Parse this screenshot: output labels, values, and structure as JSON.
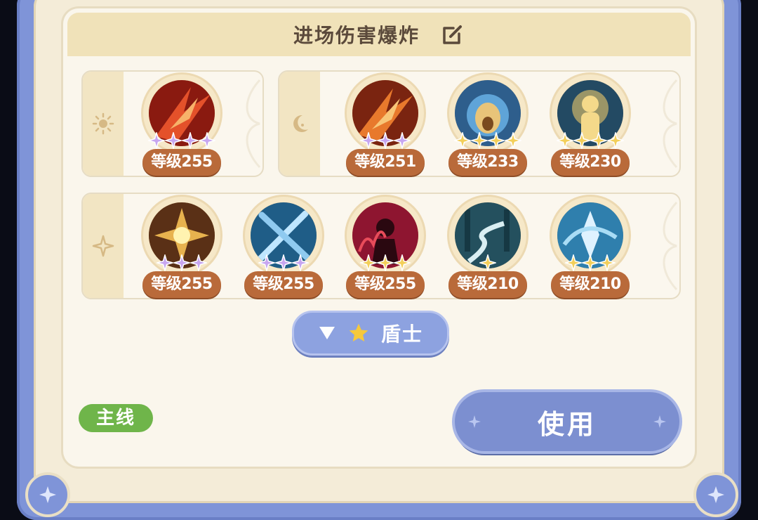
{
  "title": "进场伤害爆炸",
  "groups": [
    {
      "name": "sun",
      "icon": "sun-icon",
      "skills": [
        {
          "icon": "flame-slash-icon",
          "level_text": "等级255",
          "stars": 4,
          "star_color": "purple"
        }
      ]
    },
    {
      "name": "moon",
      "icon": "moon-icon",
      "skills": [
        {
          "icon": "flame-slash-icon",
          "level_text": "等级251",
          "stars": 3,
          "star_color": "purple"
        },
        {
          "icon": "lion-roar-icon",
          "level_text": "等级233",
          "stars": 4,
          "star_color": "gold"
        },
        {
          "icon": "golden-warrior-icon",
          "level_text": "等级230",
          "stars": 4,
          "star_color": "gold"
        }
      ]
    },
    {
      "name": "star",
      "icon": "sparkle-icon",
      "skills": [
        {
          "icon": "golden-star-burst-icon",
          "level_text": "等级255",
          "stars": 3,
          "star_color": "purple"
        },
        {
          "icon": "crossed-swords-icon",
          "level_text": "等级255",
          "stars": 3,
          "star_color": "purple"
        },
        {
          "icon": "demon-shadow-icon",
          "level_text": "等级255",
          "stars": 3,
          "star_color": "gold"
        },
        {
          "icon": "forest-path-icon",
          "level_text": "等级210",
          "stars": 1,
          "star_color": "gold"
        },
        {
          "icon": "crystal-wind-icon",
          "level_text": "等级210",
          "stars": 3,
          "star_color": "gold"
        }
      ]
    }
  ],
  "filter": {
    "label": "盾士"
  },
  "tag": {
    "label": "主线"
  },
  "use_button": {
    "label": "使用"
  },
  "colors": {
    "frame_blue": "#7f94d8",
    "level_badge": "#b96a3a",
    "tag_green": "#6fb54a",
    "star_purple": "#c7a6f0",
    "star_gold": "#f3cf5a"
  }
}
